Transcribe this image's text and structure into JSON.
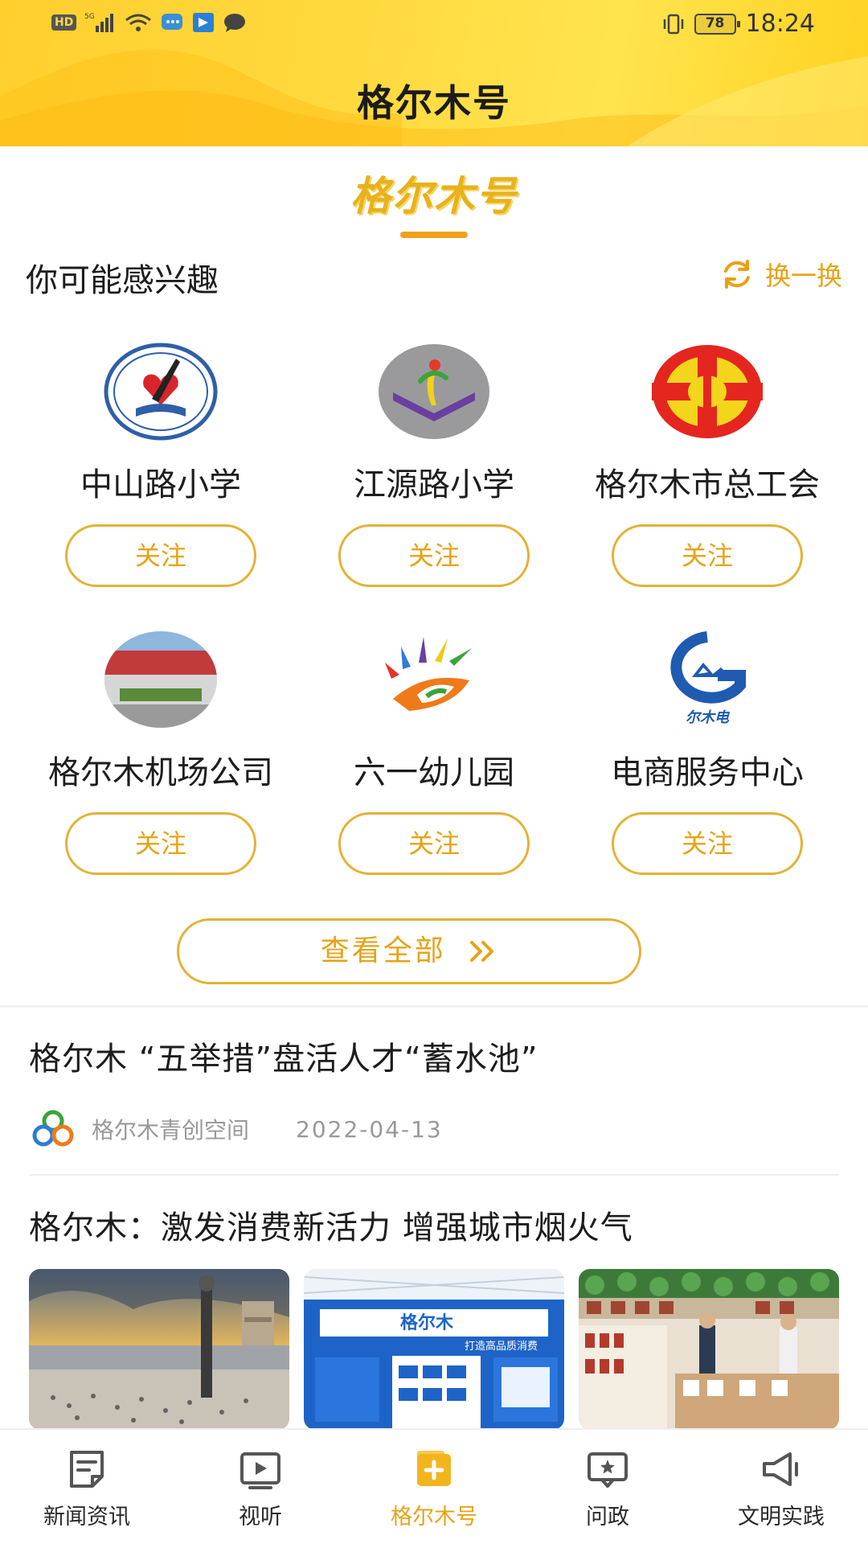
{
  "status_bar": {
    "left_badges": [
      "HD",
      "5G"
    ],
    "battery": "78",
    "time": "18:24"
  },
  "header": {
    "title": "格尔木号"
  },
  "brand": {
    "logo_text": "格尔木号"
  },
  "recommend": {
    "title": "你可能感兴趣",
    "refresh_label": "换一换",
    "items": [
      {
        "name": "中山路小学",
        "follow_label": "关注",
        "avatar_icon": "school-emblem-icon"
      },
      {
        "name": "江源路小学",
        "follow_label": "关注",
        "avatar_icon": "school-logo-icon"
      },
      {
        "name": "格尔木市总工会",
        "follow_label": "关注",
        "avatar_icon": "union-emblem-icon"
      },
      {
        "name": "格尔木机场公司",
        "follow_label": "关注",
        "avatar_icon": "airport-photo-icon"
      },
      {
        "name": "六一幼儿园",
        "follow_label": "关注",
        "avatar_icon": "kindergarten-logo-icon"
      },
      {
        "name": "电商服务中心",
        "follow_label": "关注",
        "avatar_icon": "ecommerce-logo-icon",
        "avatar_text": "尔木电"
      }
    ],
    "view_all_label": "查看全部"
  },
  "news": [
    {
      "title": "格尔木 “五举措”盘活人才“蓄水池”",
      "source": "格尔木青创空间",
      "date": "2022-04-13"
    },
    {
      "title": "格尔木：激发消费新活力  增强城市烟火气",
      "image_texts": [
        "格尔木",
        "打造高品质消费"
      ]
    }
  ],
  "bottom_nav": [
    {
      "label": "新闻资讯",
      "icon": "news-icon",
      "active": false
    },
    {
      "label": "视听",
      "icon": "video-icon",
      "active": false
    },
    {
      "label": "格尔木号",
      "icon": "account-icon",
      "active": true
    },
    {
      "label": "问政",
      "icon": "inquiry-icon",
      "active": false
    },
    {
      "label": "文明实践",
      "icon": "megaphone-icon",
      "active": false
    }
  ],
  "colors": {
    "accent": "#e5a417",
    "header_yellow": "#ffd93e",
    "text": "#1d1d1d"
  }
}
